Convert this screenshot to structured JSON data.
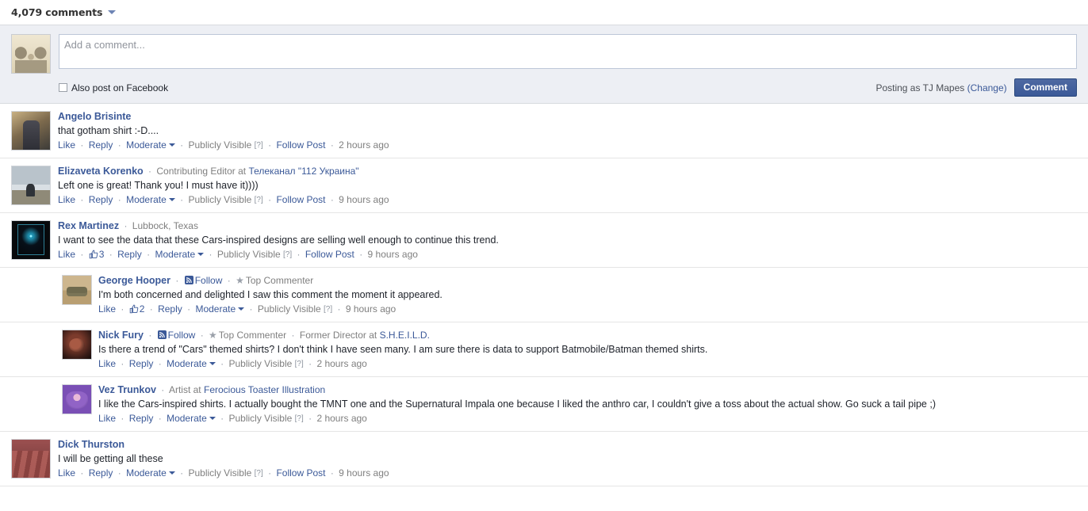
{
  "header": {
    "count_label": "4,079 comments",
    "sort_caret_icon": "chevron-down-icon"
  },
  "composer": {
    "avatar_name": "tj-mapes-avatar",
    "placeholder": "Add a comment...",
    "value": "",
    "checkbox_label": "Also post on Facebook",
    "checkbox_checked": false,
    "posting_as": "Posting as TJ Mapes",
    "change_label": "(Change)",
    "submit_label": "Comment"
  },
  "colors": {
    "link": "#3b5998",
    "meta_gray": "#7f7f7f",
    "composer_bg": "#edeff4",
    "button_bg": "#3b5998"
  },
  "actions": {
    "like": "Like",
    "reply": "Reply",
    "moderate": "Moderate",
    "visibility": "Publicly Visible",
    "help": "[?]",
    "follow_post": "Follow Post",
    "follow": "Follow",
    "top_commenter": "Top Commenter",
    "sep": "·"
  },
  "comments": [
    {
      "id": "angelo-brisinte",
      "avatar_class": "av-man-office",
      "author": "Angelo Brisinte",
      "affiliation_gray": "",
      "affiliation_link": "",
      "has_follow": false,
      "has_top_commenter": false,
      "text": "that gotham shirt :-D....",
      "like_count": "",
      "has_follow_post": true,
      "timestamp": "2 hours ago",
      "replies": []
    },
    {
      "id": "elizaveta-korenko",
      "avatar_class": "av-snow",
      "author": "Elizaveta Korenko",
      "affiliation_gray": "Contributing Editor at",
      "affiliation_link": "Телеканал \"112 Украина\"",
      "has_follow": false,
      "has_top_commenter": false,
      "text": "Left one is great! Thank you! I must have it))))",
      "like_count": "",
      "has_follow_post": true,
      "timestamp": "9 hours ago",
      "replies": []
    },
    {
      "id": "rex-martinez",
      "avatar_class": "av-poster",
      "author": "Rex Martinez",
      "affiliation_gray": "Lubbock, Texas",
      "affiliation_link": "",
      "has_follow": false,
      "has_top_commenter": false,
      "text": "I want to see the data that these Cars-inspired designs are selling well enough to continue this trend.",
      "like_count": "3",
      "has_follow_post": true,
      "timestamp": "9 hours ago",
      "replies": [
        {
          "id": "george-hooper",
          "avatar_class": "av-tank",
          "author": "George Hooper",
          "affiliation_gray": "",
          "affiliation_link": "",
          "has_follow": true,
          "has_top_commenter": true,
          "text": "I'm both concerned and delighted I saw this comment the moment it appeared.",
          "like_count": "2",
          "has_follow_post": false,
          "timestamp": "9 hours ago"
        },
        {
          "id": "nick-fury",
          "avatar_class": "av-fury",
          "author": "Nick Fury",
          "affiliation_gray": "Former Director at",
          "affiliation_link": "S.H.E.I.L.D.",
          "has_follow": true,
          "has_top_commenter": true,
          "text": "Is there a trend of \"Cars\" themed shirts? I don't think I have seen many. I am sure there is data to support Batmobile/Batman themed shirts.",
          "like_count": "",
          "has_follow_post": false,
          "timestamp": "2 hours ago"
        },
        {
          "id": "vez-trunkov",
          "avatar_class": "av-car",
          "author": "Vez Trunkov",
          "affiliation_gray": "Artist at",
          "affiliation_link": "Ferocious Toaster Illustration",
          "has_follow": false,
          "has_top_commenter": false,
          "text": "I like the Cars-inspired shirts. I actually bought the TMNT one and the Supernatural Impala one because I liked the anthro car, I couldn't give a toss about the actual show. Go suck a tail pipe ;)",
          "like_count": "",
          "has_follow_post": false,
          "timestamp": "2 hours ago"
        }
      ]
    },
    {
      "id": "dick-thurston",
      "avatar_class": "av-meat",
      "author": "Dick Thurston",
      "affiliation_gray": "",
      "affiliation_link": "",
      "has_follow": false,
      "has_top_commenter": false,
      "text": "I will be getting all these",
      "like_count": "",
      "has_follow_post": true,
      "timestamp": "9 hours ago",
      "replies": []
    }
  ]
}
